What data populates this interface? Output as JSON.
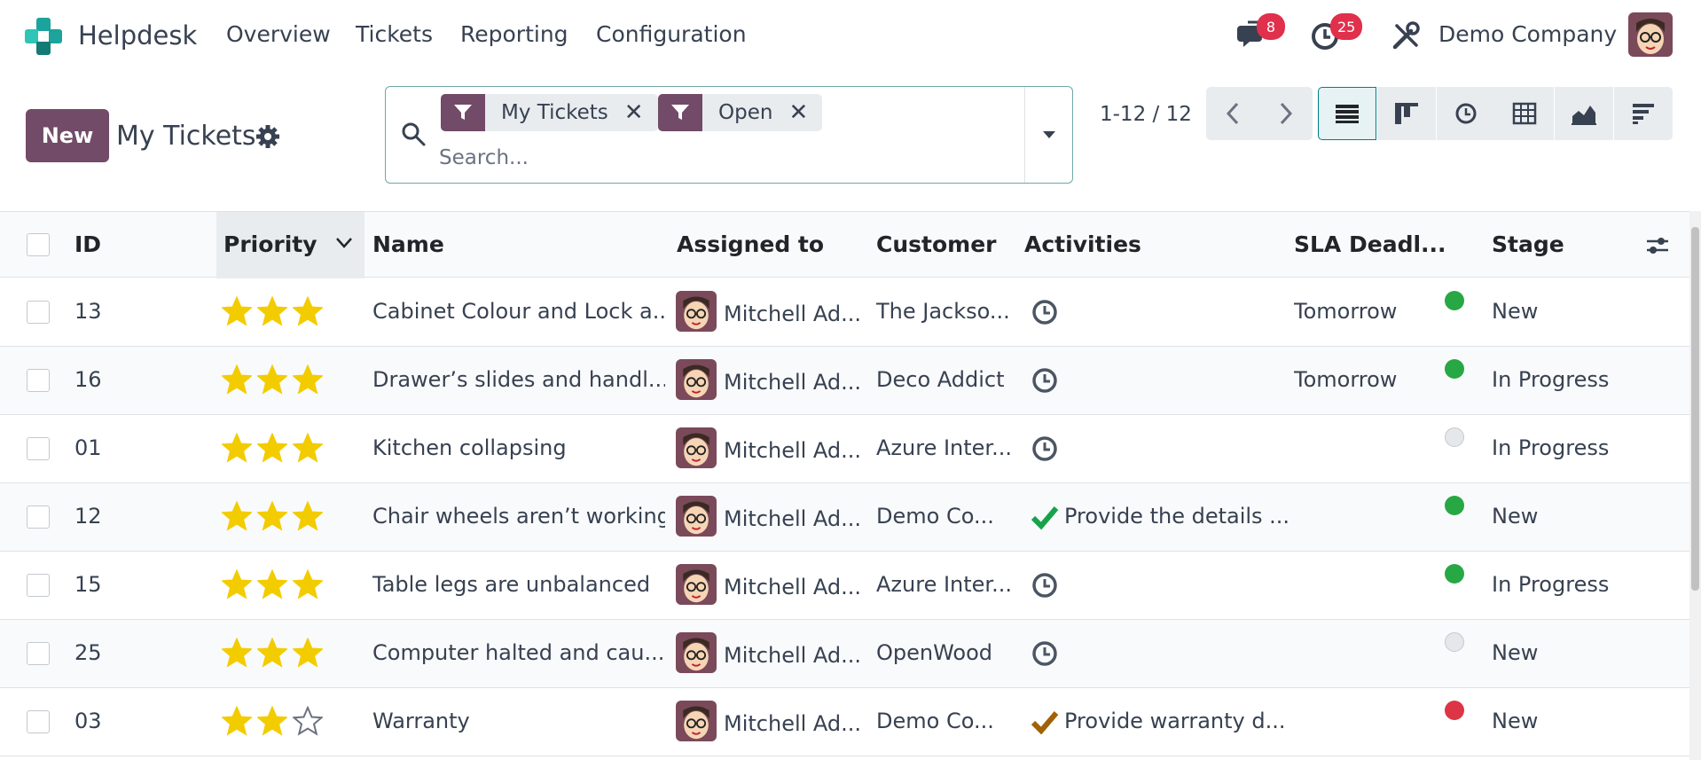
{
  "navbar": {
    "app_name": "Helpdesk",
    "menu": [
      "Overview",
      "Tickets",
      "Reporting",
      "Configuration"
    ],
    "messages_badge": "8",
    "activities_badge": "25",
    "company": "Demo Company"
  },
  "control": {
    "new_label": "New",
    "title": "My Tickets",
    "facets": [
      "My Tickets",
      "Open"
    ],
    "search_placeholder": "Search...",
    "pager": "1-12 / 12"
  },
  "columns": {
    "id": "ID",
    "priority": "Priority",
    "name": "Name",
    "assigned": "Assigned to",
    "customer": "Customer",
    "activities": "Activities",
    "sla": "SLA Deadl...",
    "stage": "Stage"
  },
  "rows": [
    {
      "id": "13",
      "stars": 3,
      "name": "Cabinet Colour and Lock a...",
      "assigned": "Mitchell Ad...",
      "customer": "The Jackso...",
      "activity": "clock",
      "activity_text": "",
      "sla": "Tomorrow",
      "status": "green",
      "stage": "New"
    },
    {
      "id": "16",
      "stars": 3,
      "name": "Drawer’s slides and handl...",
      "assigned": "Mitchell Ad...",
      "customer": "Deco Addict",
      "activity": "clock",
      "activity_text": "",
      "sla": "Tomorrow",
      "status": "green",
      "stage": "In Progress"
    },
    {
      "id": "01",
      "stars": 3,
      "name": "Kitchen collapsing",
      "assigned": "Mitchell Ad...",
      "customer": "Azure Inter...",
      "activity": "clock",
      "activity_text": "",
      "sla": "",
      "status": "grey",
      "stage": "In Progress"
    },
    {
      "id": "12",
      "stars": 3,
      "name": "Chair wheels aren’t working",
      "assigned": "Mitchell Ad...",
      "customer": "Demo Co...",
      "activity": "check-green",
      "activity_text": "Provide the details ...",
      "sla": "",
      "status": "green",
      "stage": "New"
    },
    {
      "id": "15",
      "stars": 3,
      "name": "Table legs are unbalanced",
      "assigned": "Mitchell Ad...",
      "customer": "Azure Inter...",
      "activity": "clock",
      "activity_text": "",
      "sla": "",
      "status": "green",
      "stage": "In Progress"
    },
    {
      "id": "25",
      "stars": 3,
      "name": "Computer halted and cau...",
      "assigned": "Mitchell Ad...",
      "customer": "OpenWood",
      "activity": "clock",
      "activity_text": "",
      "sla": "",
      "status": "grey",
      "stage": "New"
    },
    {
      "id": "03",
      "stars": 2,
      "name": "Warranty",
      "assigned": "Mitchell Ad...",
      "customer": "Demo Co...",
      "activity": "check-orange",
      "activity_text": "Provide warranty d...",
      "sla": "",
      "status": "red",
      "stage": "New"
    }
  ],
  "colors": {
    "brand": "#714b67",
    "accent": "#017e84",
    "star": "#f3cc00",
    "status_green": "#28a745",
    "status_red": "#dc3545",
    "status_grey": "#e5e7eb"
  }
}
